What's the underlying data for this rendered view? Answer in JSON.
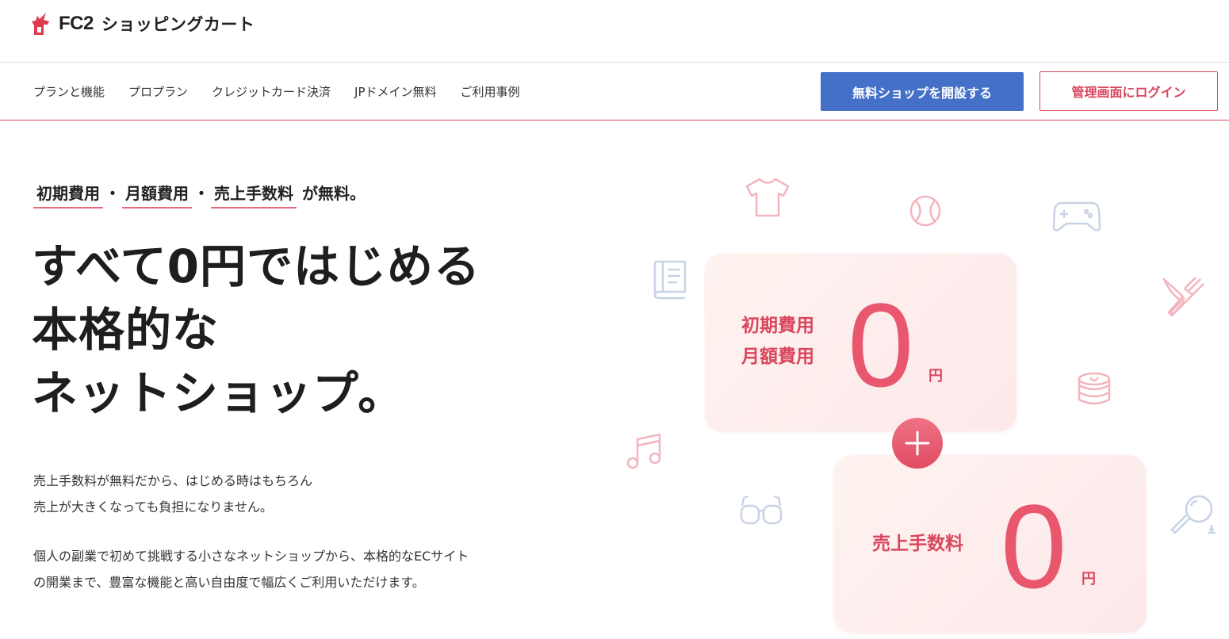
{
  "header": {
    "logo_fc2": "FC2",
    "logo_text": "ショッピングカート"
  },
  "nav": {
    "links": [
      "プランと機能",
      "プロプラン",
      "クレジットカード決済",
      "JPドメイン無料",
      "ご利用事例"
    ],
    "open_shop_button": "無料ショップを開設する",
    "login_button": "管理画面にログイン"
  },
  "hero": {
    "tags": [
      "初期費用",
      "月額費用",
      "売上手数料"
    ],
    "tag_separator": "・",
    "tag_suffix": "が無料。",
    "title_lines": [
      "すべて0円ではじめる",
      "本格的な",
      "ネットショップ。"
    ],
    "desc1_lines": [
      "売上手数料が無料だから、はじめる時はもちろん",
      "売上が大きくなっても負担になりません。"
    ],
    "desc2_lines": [
      "個人の副業で初めて挑戦する小さなネットショップから、本格的なECサイト",
      "の開業まで、豊富な機能と高い自由度で幅広くご利用いただけます。"
    ]
  },
  "cards": {
    "card1": {
      "labels": [
        "初期費用",
        "月額費用"
      ],
      "value": "0",
      "unit": "円"
    },
    "card2": {
      "labels": [
        "売上手数料"
      ],
      "value": "0",
      "unit": "円"
    }
  },
  "colors": {
    "accent_red": "#d9475e",
    "button_blue": "#4471c7"
  },
  "decorative_icons": [
    "tshirt-icon",
    "baseball-icon",
    "gamepad-icon",
    "book-icon",
    "fork-knife-icon",
    "pancake-icon",
    "music-note-icon",
    "glasses-icon",
    "magnifier-icon",
    "plus-icon"
  ]
}
